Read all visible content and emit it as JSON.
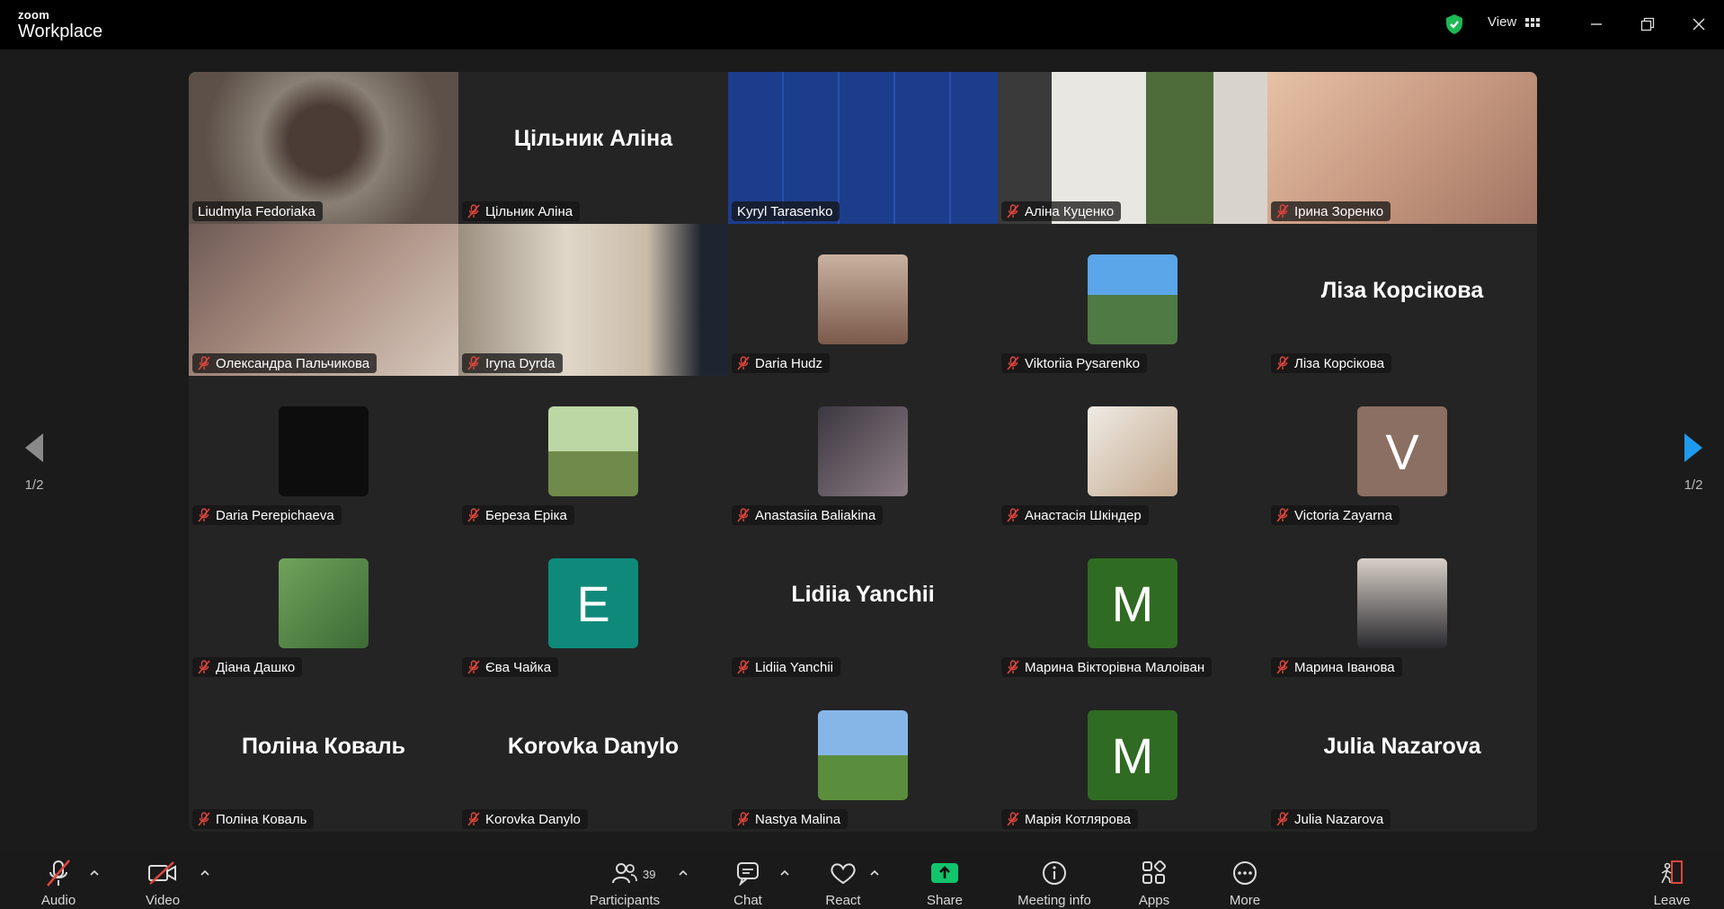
{
  "app": {
    "logo_small": "zoom",
    "logo_large": "Workplace",
    "view_label": "View"
  },
  "pages": {
    "left": "1/2",
    "right": "1/2"
  },
  "tiles": [
    {
      "name": "Liudmyla Fedoriaka",
      "type": "video",
      "muted": false,
      "active": true
    },
    {
      "name": "Цільник Аліна",
      "type": "name",
      "big": "Цільник Аліна",
      "muted": true
    },
    {
      "name": "Kyryl Tarasenko",
      "type": "video",
      "muted": false
    },
    {
      "name": "Аліна Куценко",
      "type": "video",
      "muted": true
    },
    {
      "name": "Ірина Зоренко",
      "type": "video",
      "muted": true
    },
    {
      "name": "Олександра Пальчикова",
      "type": "video",
      "muted": true
    },
    {
      "name": "Iryna Dyrda",
      "type": "video",
      "muted": true
    },
    {
      "name": "Daria Hudz",
      "type": "avatar",
      "muted": true
    },
    {
      "name": "Viktoriia Pysarenko",
      "type": "avatar",
      "muted": true
    },
    {
      "name": "Ліза Корсікова",
      "type": "name",
      "big": "Ліза Корсікова",
      "muted": true
    },
    {
      "name": "Daria Perepichaeva",
      "type": "avatar",
      "muted": true
    },
    {
      "name": "Береза Еріка",
      "type": "avatar",
      "muted": true
    },
    {
      "name": "Anastasiia Baliakina",
      "type": "avatar",
      "muted": true
    },
    {
      "name": "Анастасія Шкіндер",
      "type": "avatar",
      "muted": true
    },
    {
      "name": "Victoria Zayarna",
      "type": "letter",
      "letter": "V",
      "color": "#8a6f62",
      "muted": true
    },
    {
      "name": "Діана Дашко",
      "type": "avatar",
      "muted": true
    },
    {
      "name": "Єва Чайка",
      "type": "letter",
      "letter": "E",
      "color": "#0f8a7a",
      "muted": true
    },
    {
      "name": "Lidiia Yanchii",
      "type": "name",
      "big": "Lidiia Yanchii",
      "muted": true
    },
    {
      "name": "Марина  Вікторівна Малоіван",
      "type": "letter",
      "letter": "M",
      "color": "#2f6b22",
      "muted": true
    },
    {
      "name": "Марина Іванова",
      "type": "avatar",
      "muted": true
    },
    {
      "name": "Поліна Коваль",
      "type": "name",
      "big": "Поліна Коваль",
      "muted": true
    },
    {
      "name": "Korovka Danylo",
      "type": "name",
      "big": "Korovka Danylo",
      "muted": true
    },
    {
      "name": "Nastya Malina",
      "type": "avatar",
      "muted": true
    },
    {
      "name": "Марія Котлярова",
      "type": "letter",
      "letter": "M",
      "color": "#2f6b22",
      "muted": true
    },
    {
      "name": "Julia Nazarova",
      "type": "name",
      "big": "Julia Nazarova",
      "muted": true
    }
  ],
  "toolbar": {
    "audio": "Audio",
    "video": "Video",
    "participants": "Participants",
    "participants_count": "39",
    "chat": "Chat",
    "react": "React",
    "share": "Share",
    "meeting_info": "Meeting info",
    "apps": "Apps",
    "more": "More",
    "leave": "Leave"
  },
  "colors": {
    "share": "#12c46b",
    "active_border": "#1fd67c",
    "mute": "#e0463c",
    "nav_right": "#1e9bf0"
  }
}
